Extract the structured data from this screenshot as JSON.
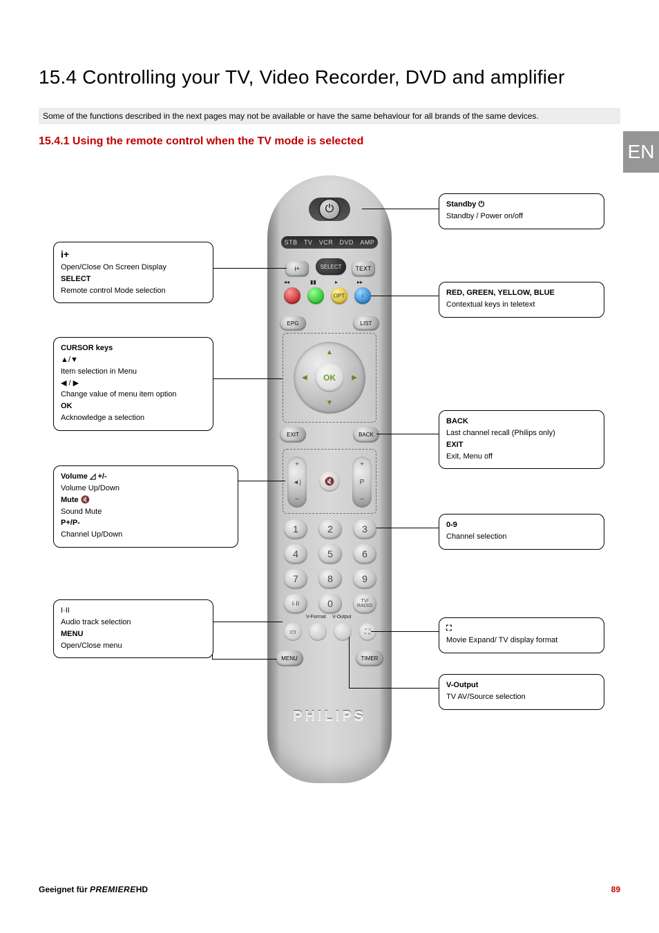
{
  "lang_tab": "EN",
  "heading": "15.4 Controlling your TV, Video Recorder, DVD and amplifier",
  "note": "Some of the functions described in the next pages may not be available or have the same behaviour for all brands of the same devices.",
  "subheading": "15.4.1 Using the remote control when the TV mode is selected",
  "remote": {
    "modes": [
      "STB",
      "TV",
      "VCR",
      "DVD",
      "AMP"
    ],
    "osd_label": "i+",
    "select_label": "SELECT",
    "text_label": "TEXT",
    "opt_label": "OPT",
    "info_label": "i",
    "epg_label": "EPG",
    "list_label": "LIST",
    "ok_label": "OK",
    "exit_label": "EXIT",
    "back_label": "BACK",
    "vol_plus": "+",
    "vol_minus": "−",
    "vol_icon": "◄)",
    "prog_plus": "+",
    "prog_minus": "−",
    "prog_label": "P",
    "mute_icon": "✕",
    "keys": [
      "1",
      "2",
      "3",
      "4",
      "5",
      "6",
      "7",
      "8",
      "9"
    ],
    "iii_label": "I·II",
    "zero": "0",
    "tvradio_label": "TV/\nRADIO",
    "vformat_label": "V-Format",
    "voutput_label": "V-Output",
    "aspect_icon": "▭",
    "expand_icon": "⛶",
    "menu_label": "MENU",
    "timer_label": "TIMER",
    "brand": "PHILIPS"
  },
  "callouts": {
    "standby": {
      "title": "Standby  ⏻",
      "desc": "Standby / Power on/off"
    },
    "osd": {
      "icon": "i+",
      "osd_desc": "Open/Close On Screen Display",
      "select_title": "SELECT",
      "select_desc": "Remote control Mode selection"
    },
    "colors": {
      "title": "RED, GREEN, YELLOW, BLUE",
      "desc": "Contextual keys in teletext"
    },
    "cursor": {
      "title": "CURSOR keys",
      "ud": "▲/▼",
      "ud_desc": "Item selection in Menu",
      "lr": "◀ / ▶",
      "lr_desc": "Change value of menu item option",
      "ok": "OK",
      "ok_desc": "Acknowledge a selection"
    },
    "back": {
      "title": "BACK",
      "desc": "Last channel recall (Philips only)",
      "exit_title": "EXIT",
      "exit_desc": "Exit, Menu off"
    },
    "vol": {
      "vol_title": "Volume ◿ +/-",
      "vol_desc": "Volume Up/Down",
      "mute_title": "Mute  🔇",
      "mute_desc": "Sound Mute",
      "p_title": "P+/P-",
      "p_desc": "Channel Up/Down"
    },
    "digits": {
      "title": "0-9",
      "desc": "Channel selection"
    },
    "audio": {
      "icon": "I·II",
      "audio_desc": "Audio track selection",
      "menu_title": "MENU",
      "menu_desc": "Open/Close menu"
    },
    "expand": {
      "icon": "⛶",
      "desc": "Movie Expand/ TV display format"
    },
    "vout": {
      "title": "V-Output",
      "desc": "TV AV/Source selection"
    }
  },
  "footer": {
    "prefix": "Geeignet für ",
    "brand": "PREMIERE",
    "suffix": "HD",
    "page": "89"
  }
}
